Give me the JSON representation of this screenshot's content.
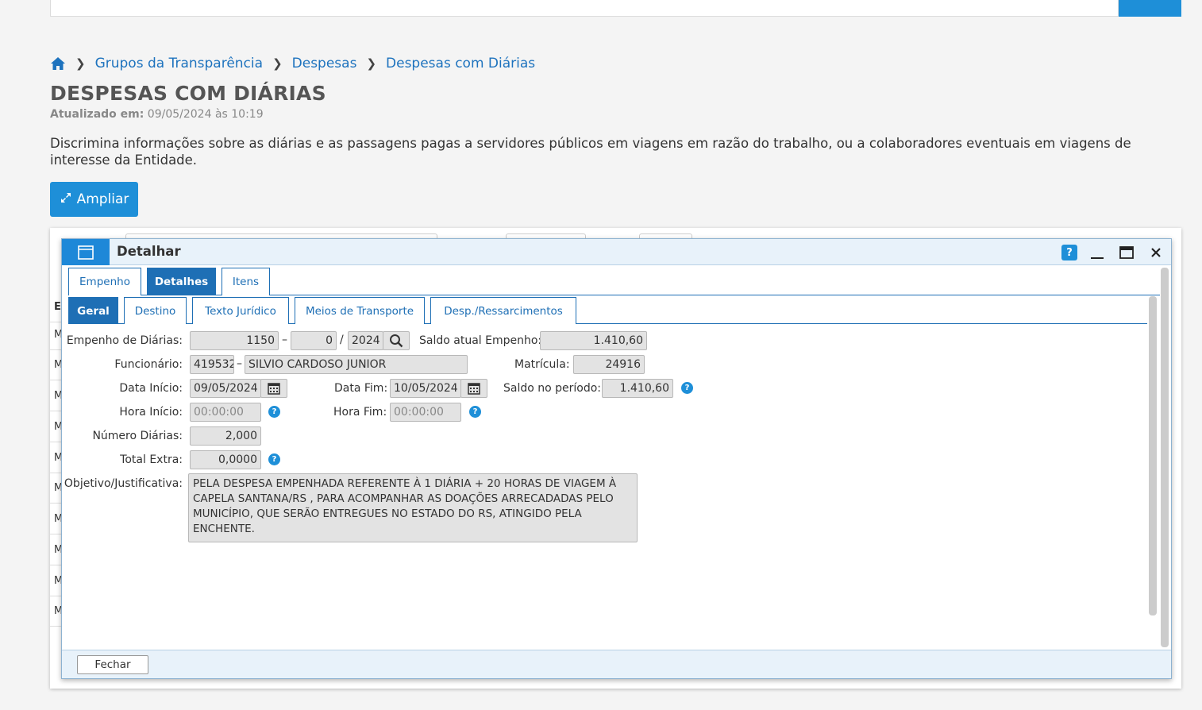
{
  "breadcrumb": {
    "items": [
      "Grupos da Transparência",
      "Despesas",
      "Despesas com Diárias"
    ]
  },
  "page": {
    "title": "DESPESAS COM DIÁRIAS",
    "updated_label": "Atualizado em:",
    "updated_value": "09/05/2024 às 10:19",
    "description": "Discrimina informações sobre as diárias e as passagens pagas a servidores públicos em viagens em razão do trabalho, ou a colaboradores eventuais em viagens de interesse da Entidade.",
    "ampliar_label": "Ampliar"
  },
  "grid": {
    "header_letter": "E",
    "row_letters": [
      "M",
      "M",
      "M",
      "M",
      "M",
      "M",
      "M",
      "M",
      "M",
      "M"
    ]
  },
  "dialog": {
    "title": "Detalhar",
    "help": "?",
    "tabs_main": [
      "Empenho",
      "Detalhes",
      "Itens"
    ],
    "tabs_main_active": "Detalhes",
    "tabs_sub": [
      "Geral",
      "Destino",
      "Texto Jurídico",
      "Meios de Transporte",
      "Desp./Ressarcimentos"
    ],
    "tabs_sub_active": "Geral",
    "close_label": "Fechar"
  },
  "form": {
    "empenho_label": "Empenho de Diárias:",
    "empenho_numero": "1150",
    "empenho_sub": "0",
    "empenho_ano": "2024",
    "saldo_atual_label": "Saldo atual Empenho:",
    "saldo_atual": "1.410,60",
    "funcionario_label": "Funcionário:",
    "funcionario_codigo": "419532",
    "funcionario_nome": "SILVIO CARDOSO JUNIOR",
    "matricula_label": "Matrícula:",
    "matricula": "24916",
    "data_inicio_label": "Data Início:",
    "data_inicio": "09/05/2024",
    "data_fim_label": "Data Fim:",
    "data_fim": "10/05/2024",
    "saldo_periodo_label": "Saldo no período:",
    "saldo_periodo": "1.410,60",
    "hora_inicio_label": "Hora Início:",
    "hora_inicio": "00:00:00",
    "hora_fim_label": "Hora Fim:",
    "hora_fim": "00:00:00",
    "numero_diarias_label": "Número Diárias:",
    "numero_diarias": "2,000",
    "total_extra_label": "Total Extra:",
    "total_extra": "0,0000",
    "objetivo_label": "Objetivo/Justificativa:",
    "objetivo": "PELA DESPESA EMPENHADA REFERENTE À 1 DIÁRIA + 20 HORAS DE  VIAGEM À CAPELA SANTANA/RS ,  PARA  ACOMPANHAR AS DOAÇÕES ARRECADADAS PELO MUNICÍPIO, QUE SERÃO ENTREGUES NO ESTADO DO RS, ATINGIDO PELA ENCHENTE."
  },
  "colors": {
    "accent": "#1e8fd8",
    "tab_active": "#1e6fb5",
    "link": "#1e73be"
  }
}
